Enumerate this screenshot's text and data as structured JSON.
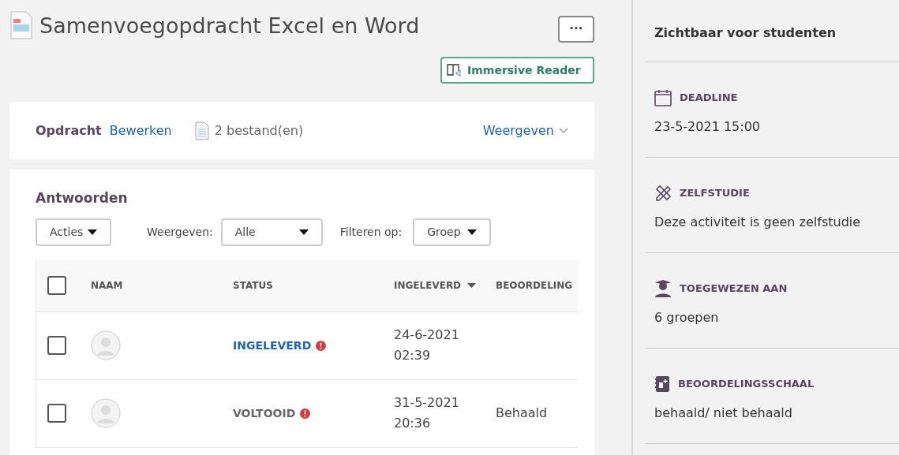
{
  "title": "Samenvoegopdracht Excel en Word",
  "more_button": "•••",
  "immersive_reader": "Immersive Reader",
  "assignment": {
    "label": "Opdracht",
    "edit_link": "Bewerken",
    "files": "2 bestand(en)",
    "view_link": "Weergeven"
  },
  "answers": {
    "heading": "Antwoorden",
    "actions": "Acties",
    "show_label": "Weergeven:",
    "show_value": "Alle",
    "filter_label": "Filteren op:",
    "filter_value": "Groep",
    "table": {
      "header_checked": false,
      "columns": [
        "NAAM",
        "STATUS",
        "INGELEVERD",
        "BEOORDELING"
      ],
      "rows": [
        {
          "checked": false,
          "status": "INGELEVERD",
          "kind": "submitted",
          "date": "24-6-2021",
          "time": "02:39"
        },
        {
          "checked": false,
          "status": "VOLTOOID",
          "kind": "completed",
          "date": "31-5-2021",
          "time": "20:36",
          "grade": "Behaald"
        }
      ]
    }
  },
  "sidebar": {
    "title": "Zichtbaar voor studenten",
    "items": [
      {
        "kind": "calendar",
        "label": "DEADLINE",
        "value": "23-5-2021 15:00"
      },
      {
        "kind": "tools",
        "label": "ZELFSTUDIE",
        "value": "Deze activiteit is geen zelfstudie"
      },
      {
        "kind": "student",
        "label": "TOEGEWEZEN AAN",
        "value": "6 groepen"
      },
      {
        "kind": "grade",
        "label": "BEOORDELINGSSCHAAL",
        "value": "behaald/ niet behaald"
      }
    ]
  }
}
